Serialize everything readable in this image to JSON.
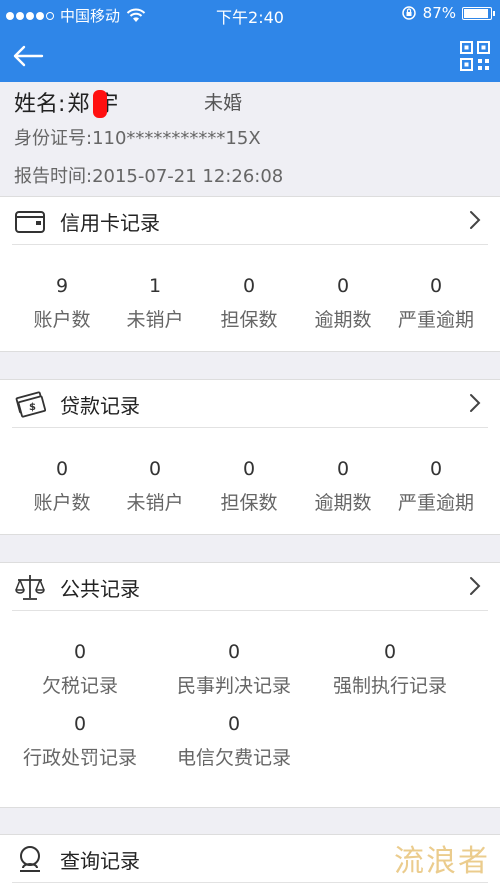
{
  "status_bar": {
    "carrier": "中国移动",
    "time": "下午2:40",
    "battery": "87%",
    "battery_level": 0.87
  },
  "colors": {
    "nav_bg": "#2f86e8",
    "page_bg": "#efeff4",
    "redaction": "#ff1010",
    "watermark": "#e8c47a"
  },
  "profile": {
    "name_label": "姓名:",
    "name_value": "郑  宇",
    "marital_status": "未婚",
    "id_number": "身份证号:110***********15X",
    "report_time": "报告时间:2015-07-21 12:26:08"
  },
  "credit_card": {
    "title": "信用卡记录",
    "icon": "card-icon",
    "stats": [
      {
        "value": "9",
        "label": "账户数"
      },
      {
        "value": "1",
        "label": "未销户"
      },
      {
        "value": "0",
        "label": "担保数"
      },
      {
        "value": "0",
        "label": "逾期数"
      },
      {
        "value": "0",
        "label": "严重逾期"
      }
    ]
  },
  "loan": {
    "title": "贷款记录",
    "icon": "money-icon",
    "stats": [
      {
        "value": "0",
        "label": "账户数"
      },
      {
        "value": "0",
        "label": "未销户"
      },
      {
        "value": "0",
        "label": "担保数"
      },
      {
        "value": "0",
        "label": "逾期数"
      },
      {
        "value": "0",
        "label": "严重逾期"
      }
    ]
  },
  "public": {
    "title": "公共记录",
    "icon": "scale-icon",
    "stats": [
      {
        "value": "0",
        "label": "欠税记录"
      },
      {
        "value": "0",
        "label": "民事判决记录"
      },
      {
        "value": "0",
        "label": "强制执行记录"
      },
      {
        "value": "0",
        "label": "行政处罚记录"
      },
      {
        "value": "0",
        "label": "电信欠费记录"
      }
    ]
  },
  "query": {
    "title": "查询记录",
    "icon": "search-person-icon"
  },
  "watermark": "流浪者"
}
